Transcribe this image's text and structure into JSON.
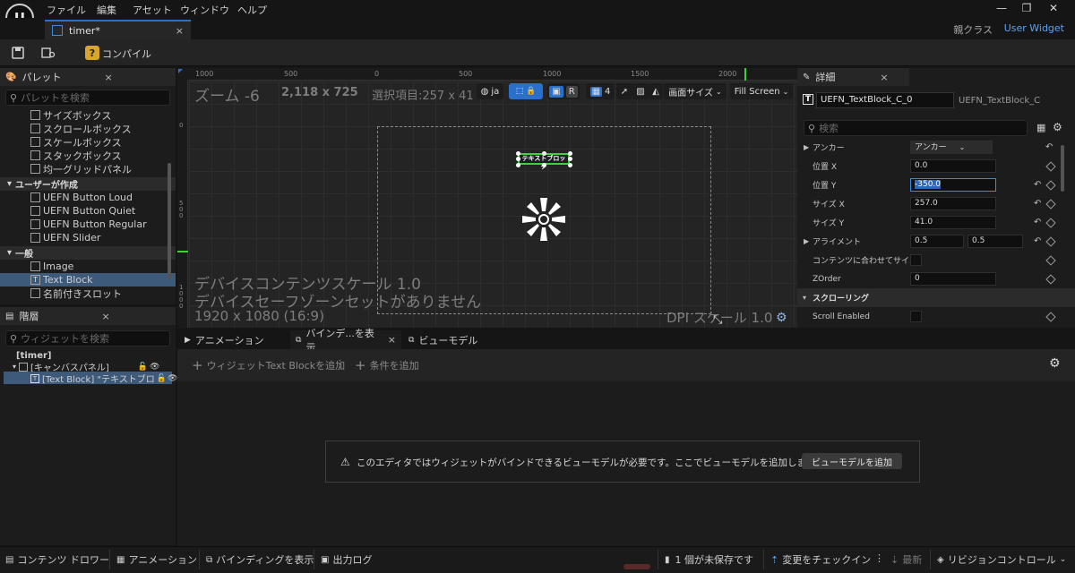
{
  "menu": {
    "items": [
      "ファイル",
      "編集",
      "アセット",
      "ウィンドウ",
      "ヘルプ"
    ]
  },
  "window_controls": {
    "minimize": "—",
    "maximize": "❐",
    "close": "✕"
  },
  "doc_tab": {
    "title": "timer*",
    "close": "×"
  },
  "header_right": {
    "parent_class_label": "親クラス",
    "parent_class_value": "User Widget"
  },
  "toolbar": {
    "compile_label": "コンパイル"
  },
  "palette": {
    "title": "パレット",
    "close": "×",
    "search_placeholder": "パレットを検索",
    "items_top": [
      "サイズボックス",
      "スクロールボックス",
      "スケールボックス",
      "スタックボックス",
      "均一グリッドパネル"
    ],
    "category_user": "ユーザーが作成",
    "items_user": [
      "UEFN Button Loud",
      "UEFN Button Quiet",
      "UEFN Button Regular",
      "UEFN Slider"
    ],
    "category_common": "一般",
    "items_common": [
      "Image",
      "Text Block",
      "名前付きスロット"
    ]
  },
  "hierarchy": {
    "title": "階層",
    "close": "×",
    "search_placeholder": "ウィジェットを検索",
    "root": "[timer]",
    "canvas": "[キャンバスパネル]",
    "textblock": "[Text Block] \"テキストブロ"
  },
  "canvas": {
    "ruler_top": [
      "1000",
      "500",
      "0",
      "500",
      "1000",
      "1500",
      "2000"
    ],
    "ruler_left": [
      "0",
      "5\n0\n0",
      "1\n0\n0\n0"
    ],
    "zoom": "ズーム -6",
    "resolution_info": "2,118 x 725",
    "selection": "選択項目:257 x 41",
    "lang": "ja",
    "grid_count": "4",
    "r_label": "R",
    "screen_size": "画面サイズ",
    "fill_screen": "Fill Screen",
    "widget_text": "テキストブロック",
    "device_scale": "デバイスコンテンツスケール 1.0",
    "safe_zone": "デバイスセーフゾーンセットがありません",
    "resolution": "1920 x 1080 (16:9)",
    "dpi_scale": "DPI スケール 1.0"
  },
  "details": {
    "title": "詳細",
    "close": "×",
    "name_value": "UEFN_TextBlock_C_0",
    "class_name": "UEFN_TextBlock_C",
    "search_placeholder": "検索",
    "rows": {
      "anchor_label": "アンカー",
      "anchor_value": "アンカー",
      "pos_x_label": "位置 X",
      "pos_x_value": "0.0",
      "pos_y_label": "位置 Y",
      "pos_y_value": "-350.0",
      "size_x_label": "サイズ X",
      "size_x_value": "257.0",
      "size_y_label": "サイズ Y",
      "size_y_value": "41.0",
      "alignment_label": "アライメント",
      "alignment_x": "0.5",
      "alignment_y": "0.5",
      "fit_content_label": "コンテンツに合わせてサイ...",
      "zorder_label": "ZOrder",
      "zorder_value": "0",
      "scrolling_section": "スクローリング",
      "scroll_enabled_label": "Scroll Enabled"
    }
  },
  "bottom_tabs": {
    "animation": "アニメーション",
    "bindings": "バインデ...を表示",
    "bindings_close": "×",
    "viewmodel": "ビューモデル"
  },
  "binding_toolbar": {
    "add_widget": "ウィジェットText Blockを追加",
    "add_condition": "条件を追加"
  },
  "notice": {
    "message": "このエディタではウィジェットがバインドできるビューモデルが必要です。ここでビューモデルを追加しますか?",
    "button": "ビューモデルを追加"
  },
  "statusbar": {
    "content_drawer": "コンテンツ ドロワー",
    "animation": "アニメーション",
    "bindings": "バインディングを表示",
    "output_log": "出力ログ",
    "unsaved": "1 個が未保存です",
    "checkin": "変更をチェックイン",
    "latest": "最新",
    "revision": "リビジョンコントロール"
  }
}
